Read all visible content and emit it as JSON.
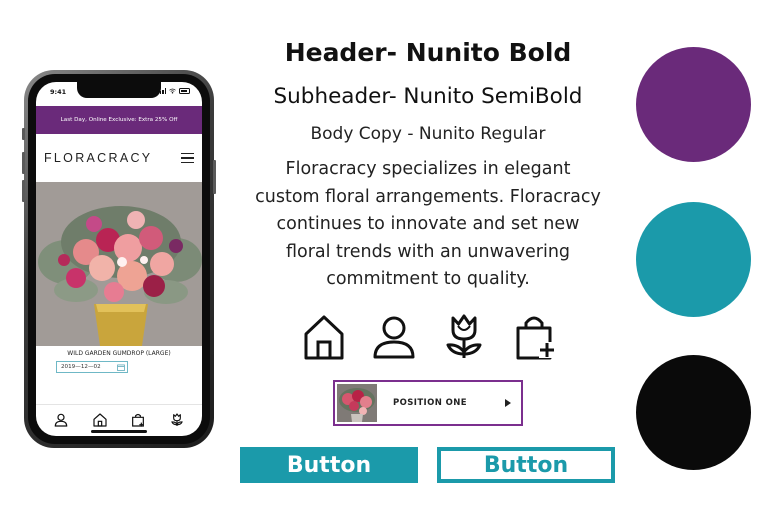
{
  "phone": {
    "status_time": "9:41",
    "promo_text": "Last Day, Online Exclusive: Extra 25% Off",
    "brand": "FLORACRACY",
    "product_name": "WILD GARDEN GUMDROP (LARGE)",
    "date_value": "2019—12—02",
    "tabs": [
      "person-icon",
      "home-icon",
      "bag-icon",
      "tulip-icon"
    ]
  },
  "typography": {
    "header": "Header- Nunito Bold",
    "subheader": "Subheader- Nunito SemiBold",
    "body_label": "Body Copy - Nunito Regular",
    "body_lines": [
      "Floracracy specializes in elegant",
      "custom floral arrangements. Floracracy",
      "continues to innovate and set new",
      "floral trends with an unwavering",
      "commitment to quality."
    ]
  },
  "icon_set": [
    "home-icon",
    "person-icon",
    "tulip-icon",
    "bag-add-icon"
  ],
  "position_card": {
    "label": "POSITION ONE"
  },
  "buttons": {
    "filled_label": "Button",
    "outline_label": "Button"
  },
  "colors": {
    "purple": "#6a2a7a",
    "teal": "#1b9aaa",
    "black": "#0a0a0a",
    "card_border": "#7b2f8e"
  }
}
